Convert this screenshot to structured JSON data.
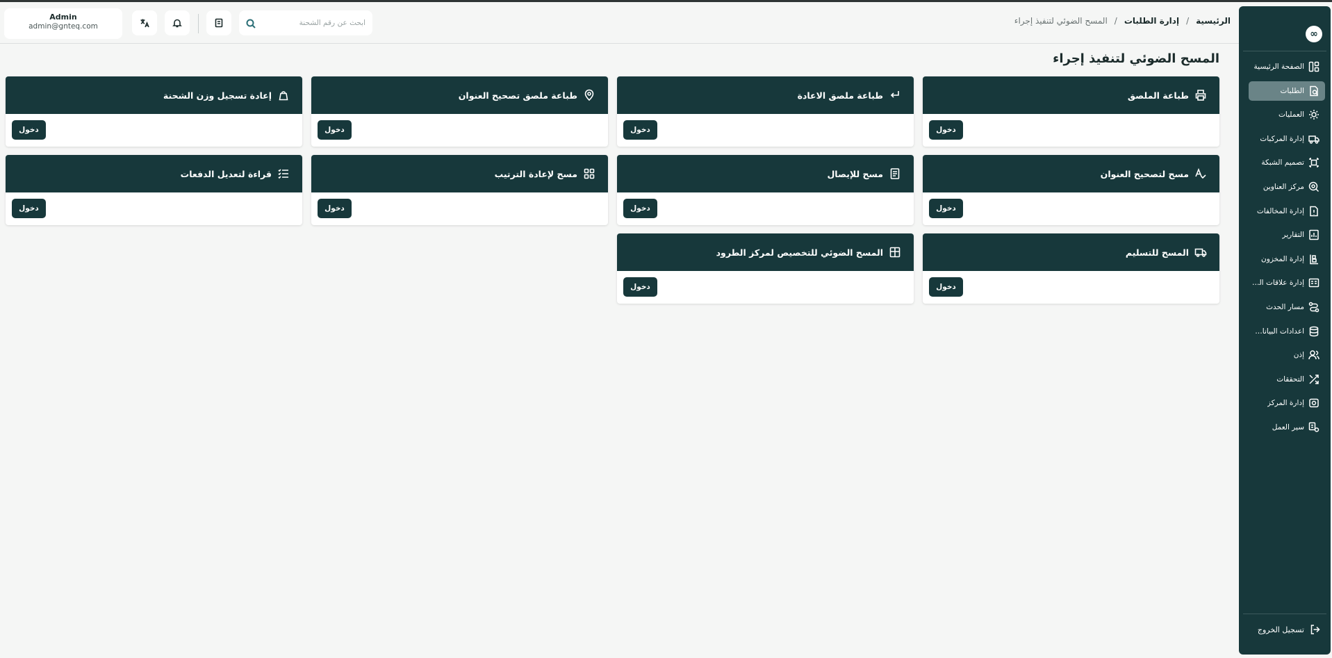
{
  "sidebar": {
    "logo": "∞",
    "items": [
      {
        "label": "الصفحة الرئيسية",
        "icon": "dashboard-icon"
      },
      {
        "label": "الطلبات",
        "icon": "orders-icon",
        "active": true
      },
      {
        "label": "العمليات",
        "icon": "operations-icon"
      },
      {
        "label": "إدارة المركبات",
        "icon": "truck-icon"
      },
      {
        "label": "تصميم الشبكة",
        "icon": "network-icon"
      },
      {
        "label": "مركز العناوين",
        "icon": "address-icon"
      },
      {
        "label": "إدارة المخالفات",
        "icon": "violations-icon"
      },
      {
        "label": "التقارير",
        "icon": "reports-icon"
      },
      {
        "label": "إدارة المخزون",
        "icon": "inventory-icon"
      },
      {
        "label": "إدارة علاقات العملاء",
        "icon": "crm-icon"
      },
      {
        "label": "مسار الحدث",
        "icon": "event-path-icon"
      },
      {
        "label": "اعدادات البيانات...",
        "icon": "database-icon"
      },
      {
        "label": "إذن",
        "icon": "users-icon"
      },
      {
        "label": "التحققات",
        "icon": "verifications-icon"
      },
      {
        "label": "إدارة المركز",
        "icon": "center-icon"
      },
      {
        "label": "سير العمل",
        "icon": "workflow-icon"
      }
    ],
    "logout_label": "تسجيل الخروج"
  },
  "header": {
    "breadcrumb": [
      "الرئيسية",
      "إدارة الطلبات",
      "المسح الضوئي لتنفيذ إجراء"
    ],
    "breadcrumb_separator": "/",
    "search_placeholder": "ابحث عن رقم الشحنة",
    "user": {
      "name": "Admin",
      "email": "admin@gnteq.com"
    }
  },
  "main": {
    "title": "المسح الضوئي لتنفيذ إجراء",
    "enter_label": "دخول",
    "cards": [
      {
        "title": "طباعة الملصق",
        "icon": "printer-icon"
      },
      {
        "title": "طباعة ملصق الاعادة",
        "icon": "return-arrow-icon"
      },
      {
        "title": "طباعة ملصق تصحيح العنوان",
        "icon": "location-pin-icon"
      },
      {
        "title": "إعادة تسجيل وزن الشحنة",
        "icon": "weight-icon"
      },
      {
        "title": "مسح لتصحيح العنوان",
        "icon": "text-check-icon"
      },
      {
        "title": "مسح للإيصال",
        "icon": "receipt-icon"
      },
      {
        "title": "مسح لإعادة الترتيب",
        "icon": "grid-icon"
      },
      {
        "title": "قراءة لتعديل الدفعات",
        "icon": "list-check-icon"
      },
      {
        "title": "المسح للتسليم",
        "icon": "delivery-truck-icon"
      },
      {
        "title": "المسح الضوئي للتخصيص لمركز الطرود",
        "icon": "layout-icon"
      }
    ]
  },
  "colors": {
    "sidebar_bg": "#17383b",
    "sidebar_active": "#6a8487",
    "card_header": "#17383b",
    "page_bg": "#f5f6f5"
  }
}
